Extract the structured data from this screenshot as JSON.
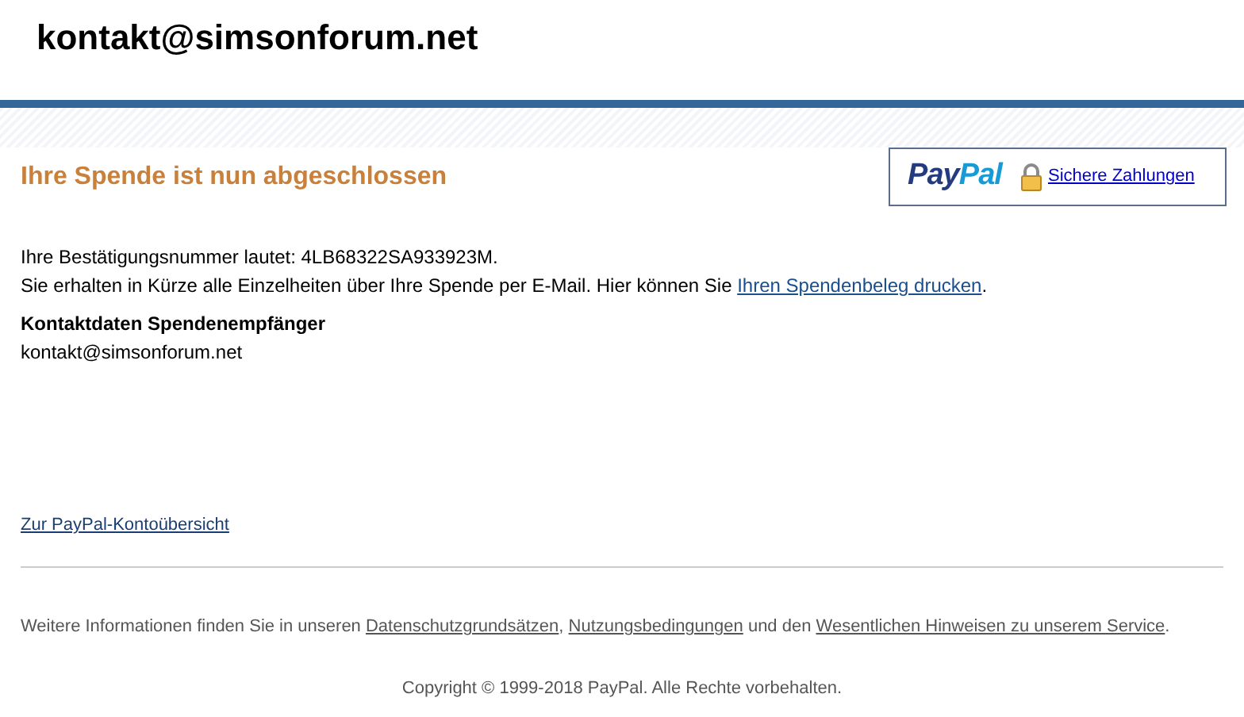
{
  "header": {
    "title": "kontakt@simsonforum.net"
  },
  "heading": "Ihre Spende ist nun abgeschlossen",
  "badge": {
    "logo": [
      {
        "text": "Pay",
        "color": "#253b80"
      },
      {
        "text": "Pal",
        "color": "#179bd7"
      }
    ],
    "link": "Sichere Zahlungen"
  },
  "confirmation": [
    [
      {
        "kind": "text",
        "text": "Ihre Bestätigungsnummer lautet: 4LB68322SA933923M."
      }
    ],
    [
      {
        "kind": "text",
        "text": "Sie erhalten in Kürze alle Einzelheiten über Ihre Spende per E-Mail. Hier können Sie "
      },
      {
        "kind": "link",
        "text": "Ihren Spendenbeleg drucken"
      },
      {
        "kind": "text",
        "text": "."
      }
    ]
  ],
  "contact": {
    "label": "Kontaktdaten Spendenempfänger",
    "value": "kontakt@simsonforum.net"
  },
  "account_link": "Zur PayPal-Kontoübersicht",
  "footer": {
    "info": [
      {
        "kind": "text",
        "text": "Weitere Informationen finden Sie in unseren "
      },
      {
        "kind": "link",
        "text": "Datenschutzgrundsätzen"
      },
      {
        "kind": "text",
        "text": ", "
      },
      {
        "kind": "link",
        "text": "Nutzungsbedingungen"
      },
      {
        "kind": "text",
        "text": " und den "
      },
      {
        "kind": "link",
        "text": "Wesentlichen Hinweisen zu unserem Service"
      },
      {
        "kind": "text",
        "text": "."
      }
    ],
    "copyright": "Copyright © 1999-2018 PayPal. Alle Rechte vorbehalten."
  }
}
